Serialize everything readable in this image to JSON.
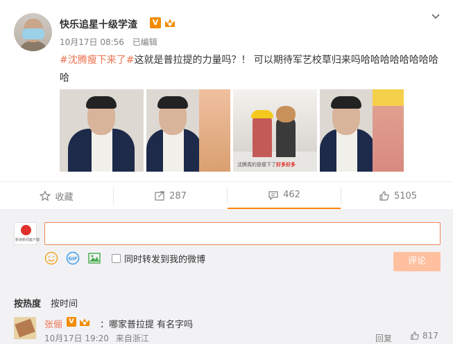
{
  "post": {
    "author": "快乐追星十级学渣",
    "verified_badge": "V",
    "date": "10月17日 08:56",
    "edited": "已编辑",
    "topic": "#沈腾瘦下来了#",
    "text": "这就是普拉提的力量吗？！ 可以期待军艺校草归来吗哈哈哈哈哈哈哈哈哈",
    "image3_caption_prefix": "沈腾真的是瘦下了",
    "image3_caption_highlight": "好多好多"
  },
  "actions": {
    "favorite": "收藏",
    "repost_count": "287",
    "comment_count": "462",
    "like_count": "5105"
  },
  "compose": {
    "placeholder": "",
    "my_avatar_caption": "新浪新闻客户端",
    "also_repost": "同时转发到我的微博",
    "submit": "评论"
  },
  "sort": {
    "hot": "按热度",
    "time": "按时间"
  },
  "comment": {
    "author": "张俪",
    "verified_badge": "V",
    "text": "：哪家普拉提 有名字吗",
    "date": "10月17日 19:20",
    "location": "来自浙江",
    "reply": "回复",
    "likes": "817"
  },
  "colors": {
    "accent": "#ff8200",
    "topic": "#eb7350",
    "submit_disabled": "#ffc09f",
    "input_border": "#f08556"
  }
}
